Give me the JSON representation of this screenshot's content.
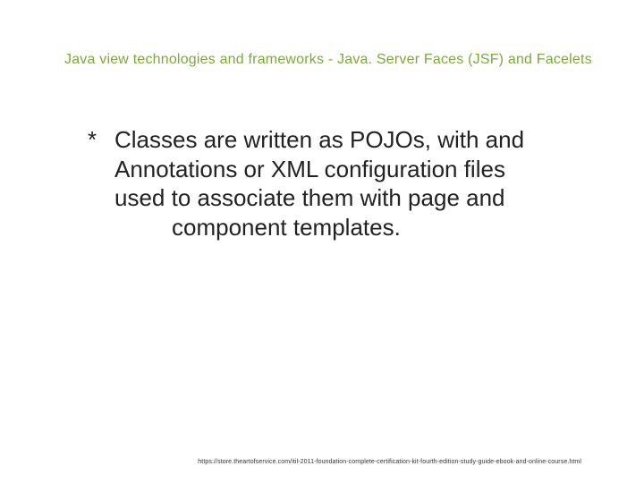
{
  "slide": {
    "title": "Java view technologies and frameworks - Java. Server Faces (JSF) and Facelets",
    "bullet_marker": " *",
    "body_line1": "Classes are written as POJOs, with and",
    "body_line2": "Annotations or XML configuration files",
    "body_line3": "used to associate them with page and",
    "body_line4": "component templates.",
    "footer": "https://store.theartofservice.com/itil-2011-foundation-complete-certification-kit-fourth-edition-study-guide-ebook-and-online-course.html"
  }
}
